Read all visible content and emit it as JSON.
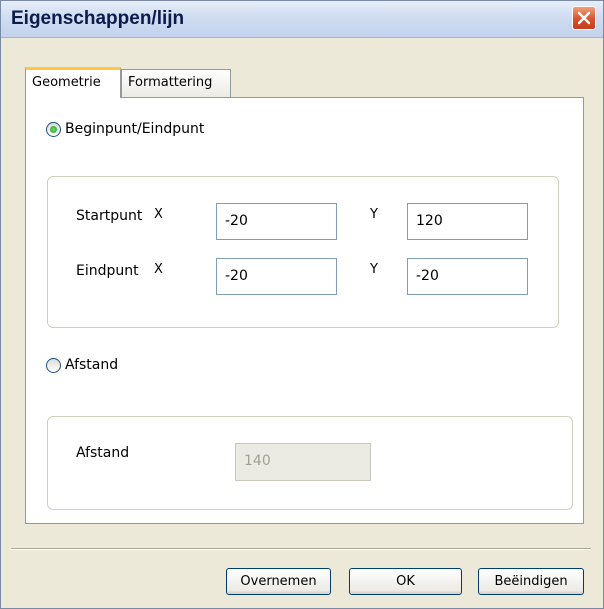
{
  "window": {
    "title": "Eigenschappen/lijn"
  },
  "tabs": [
    {
      "label": "Geometrie",
      "active": true
    },
    {
      "label": "Formattering",
      "active": false
    }
  ],
  "mode_begin_end": {
    "label": "Beginpunt/Eindpunt",
    "selected": true
  },
  "start_point": {
    "label": "Startpunt",
    "x_label": "X",
    "x_value": "-20",
    "y_label": "Y",
    "y_value": "120"
  },
  "end_point": {
    "label": "Eindpunt",
    "x_label": "X",
    "x_value": "-20",
    "y_label": "Y",
    "y_value": "-20"
  },
  "mode_distance": {
    "label": "Afstand",
    "selected": false
  },
  "distance": {
    "label": "Afstand",
    "value": "140"
  },
  "buttons": {
    "apply": "Overnemen",
    "ok": "OK",
    "close": "Beëindigen"
  }
}
